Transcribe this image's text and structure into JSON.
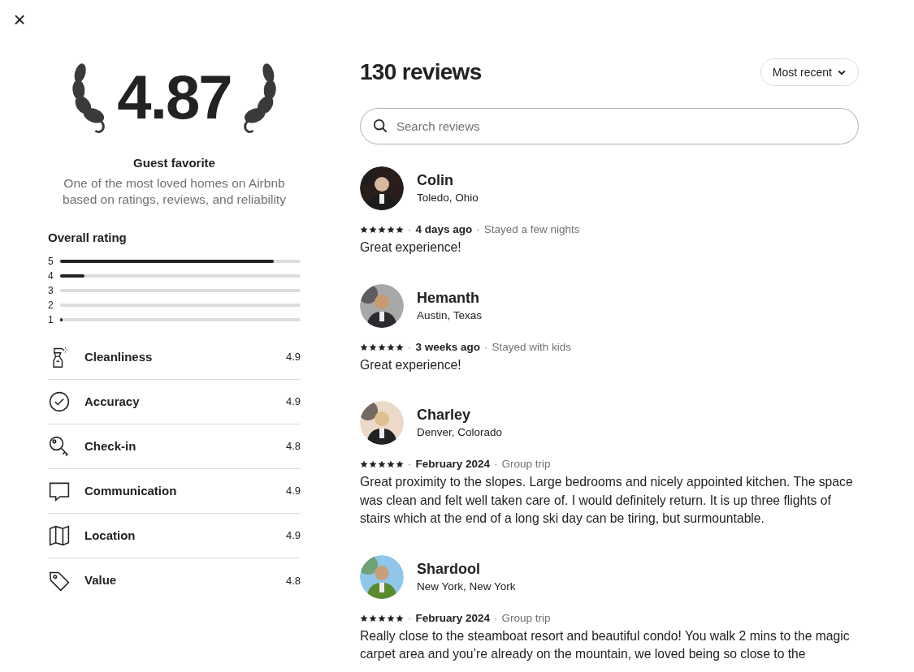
{
  "close_button": "×",
  "summary": {
    "score": "4.87",
    "badge": "Guest favorite",
    "description": "One of the most loved homes on Airbnb based on ratings, reviews, and reliability"
  },
  "overall_rating": {
    "title": "Overall rating",
    "bars": [
      {
        "label": "5",
        "level": 0.89
      },
      {
        "label": "4",
        "level": 0.1
      },
      {
        "label": "3",
        "level": 0
      },
      {
        "label": "2",
        "level": 0
      },
      {
        "label": "1",
        "level": 0.01
      }
    ]
  },
  "categories": [
    {
      "kind": "cleanliness",
      "label": "Cleanliness",
      "score": "4.9"
    },
    {
      "kind": "accuracy",
      "label": "Accuracy",
      "score": "4.9"
    },
    {
      "kind": "checkin",
      "label": "Check-in",
      "score": "4.8"
    },
    {
      "kind": "communication",
      "label": "Communication",
      "score": "4.9"
    },
    {
      "kind": "location",
      "label": "Location",
      "score": "4.9"
    },
    {
      "kind": "value",
      "label": "Value",
      "score": "4.8"
    }
  ],
  "reviews_header": {
    "title": "130 reviews",
    "sort": "Most recent"
  },
  "search": {
    "placeholder": "Search reviews"
  },
  "reviews": [
    {
      "name": "Colin",
      "location": "Toledo, Ohio",
      "stars": 5,
      "date": "4 days ago",
      "separators": [
        "·",
        "·"
      ],
      "trip": "Stayed a few nights",
      "text": "Great experience!"
    },
    {
      "name": "Hemanth",
      "location": "Austin, Texas",
      "stars": 5,
      "date": "3 weeks ago",
      "separators": [
        "·",
        "·"
      ],
      "trip": "Stayed with kids",
      "text": "Great experience!"
    },
    {
      "name": "Charley",
      "location": "Denver, Colorado",
      "stars": 5,
      "date": "February 2024",
      "separators": [
        "·",
        "·"
      ],
      "trip": "Group trip",
      "text": "Great proximity to the slopes. Large bedrooms and nicely appointed kitchen. The space was clean and felt well taken care of. I would definitely return. It is up three flights of stairs which at the end of a long ski day can be tiring, but surmountable."
    },
    {
      "name": "Shardool",
      "location": "New York, New York",
      "stars": 5,
      "date": "February 2024",
      "separators": [
        "·",
        "·"
      ],
      "trip": "Group trip",
      "text": "Really close to the steamboat resort and beautiful condo! You walk 2 mins to the magic carpet area and you’re already on the mountain, we loved being so close to the"
    }
  ]
}
